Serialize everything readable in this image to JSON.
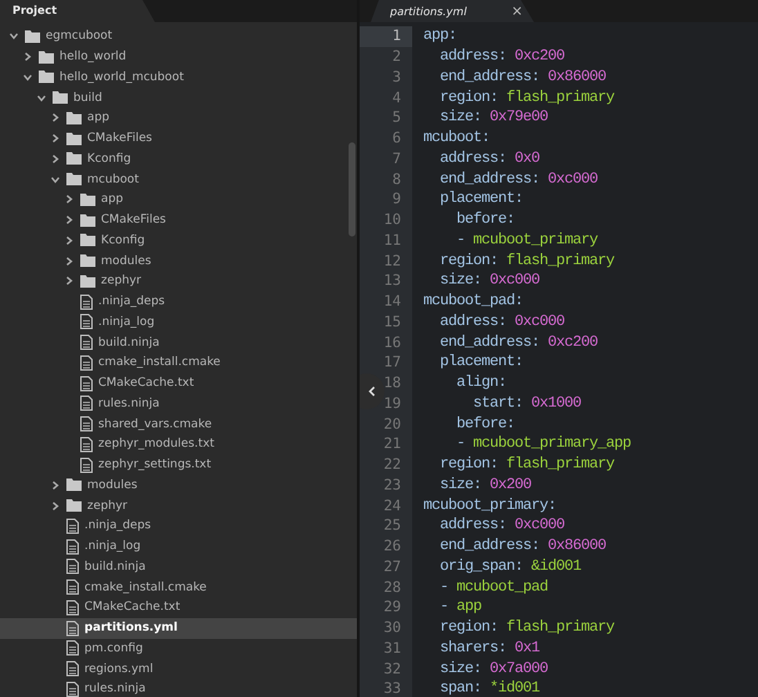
{
  "sidebar": {
    "tab": {
      "label": "Project",
      "selected": true
    },
    "tree": [
      {
        "kind": "folder",
        "name": "egmcuboot",
        "expanded": true,
        "selected": false,
        "children": [
          {
            "kind": "folder",
            "name": "hello_world",
            "expanded": false,
            "selected": false
          },
          {
            "kind": "folder",
            "name": "hello_world_mcuboot",
            "expanded": true,
            "selected": false,
            "children": [
              {
                "kind": "folder",
                "name": "build",
                "expanded": true,
                "selected": false,
                "children": [
                  {
                    "kind": "folder",
                    "name": "app",
                    "expanded": false,
                    "selected": false
                  },
                  {
                    "kind": "folder",
                    "name": "CMakeFiles",
                    "expanded": false,
                    "selected": false
                  },
                  {
                    "kind": "folder",
                    "name": "Kconfig",
                    "expanded": false,
                    "selected": false
                  },
                  {
                    "kind": "folder",
                    "name": "mcuboot",
                    "expanded": true,
                    "selected": false,
                    "children": [
                      {
                        "kind": "folder",
                        "name": "app",
                        "expanded": false,
                        "selected": false
                      },
                      {
                        "kind": "folder",
                        "name": "CMakeFiles",
                        "expanded": false,
                        "selected": false
                      },
                      {
                        "kind": "folder",
                        "name": "Kconfig",
                        "expanded": false,
                        "selected": false
                      },
                      {
                        "kind": "folder",
                        "name": "modules",
                        "expanded": false,
                        "selected": false
                      },
                      {
                        "kind": "folder",
                        "name": "zephyr",
                        "expanded": false,
                        "selected": false
                      },
                      {
                        "kind": "file",
                        "name": ".ninja_deps",
                        "selected": false
                      },
                      {
                        "kind": "file",
                        "name": ".ninja_log",
                        "selected": false
                      },
                      {
                        "kind": "file",
                        "name": "build.ninja",
                        "selected": false
                      },
                      {
                        "kind": "file",
                        "name": "cmake_install.cmake",
                        "selected": false
                      },
                      {
                        "kind": "file",
                        "name": "CMakeCache.txt",
                        "selected": false
                      },
                      {
                        "kind": "file",
                        "name": "rules.ninja",
                        "selected": false
                      },
                      {
                        "kind": "file",
                        "name": "shared_vars.cmake",
                        "selected": false
                      },
                      {
                        "kind": "file",
                        "name": "zephyr_modules.txt",
                        "selected": false
                      },
                      {
                        "kind": "file",
                        "name": "zephyr_settings.txt",
                        "selected": false
                      }
                    ]
                  },
                  {
                    "kind": "folder",
                    "name": "modules",
                    "expanded": false,
                    "selected": false
                  },
                  {
                    "kind": "folder",
                    "name": "zephyr",
                    "expanded": false,
                    "selected": false
                  },
                  {
                    "kind": "file",
                    "name": ".ninja_deps",
                    "selected": false
                  },
                  {
                    "kind": "file",
                    "name": ".ninja_log",
                    "selected": false
                  },
                  {
                    "kind": "file",
                    "name": "build.ninja",
                    "selected": false
                  },
                  {
                    "kind": "file",
                    "name": "cmake_install.cmake",
                    "selected": false
                  },
                  {
                    "kind": "file",
                    "name": "CMakeCache.txt",
                    "selected": false
                  },
                  {
                    "kind": "file",
                    "name": "partitions.yml",
                    "selected": true
                  },
                  {
                    "kind": "file",
                    "name": "pm.config",
                    "selected": false
                  },
                  {
                    "kind": "file",
                    "name": "regions.yml",
                    "selected": false
                  },
                  {
                    "kind": "file",
                    "name": "rules.ninja",
                    "selected": false
                  }
                ]
              }
            ]
          }
        ]
      }
    ]
  },
  "editor": {
    "tabs": [
      {
        "label": "partitions.yml",
        "selected": true,
        "close": "×"
      }
    ],
    "lines": [
      {
        "number": "1",
        "current": true,
        "tokens": [
          {
            "kind": "key",
            "text": "app:"
          }
        ]
      },
      {
        "number": "2",
        "current": false,
        "tokens": [
          {
            "kind": "key",
            "text": "  address:"
          },
          {
            "kind": "number",
            "text": " 0xc200"
          }
        ]
      },
      {
        "number": "3",
        "current": false,
        "tokens": [
          {
            "kind": "key",
            "text": "  end_address:"
          },
          {
            "kind": "number",
            "text": " 0x86000"
          }
        ]
      },
      {
        "number": "4",
        "current": false,
        "tokens": [
          {
            "kind": "key",
            "text": "  region:"
          },
          {
            "kind": "string",
            "text": " flash_primary"
          }
        ]
      },
      {
        "number": "5",
        "current": false,
        "tokens": [
          {
            "kind": "key",
            "text": "  size:"
          },
          {
            "kind": "number",
            "text": " 0x79e00"
          }
        ]
      },
      {
        "number": "6",
        "current": false,
        "tokens": [
          {
            "kind": "key",
            "text": "mcuboot:"
          }
        ]
      },
      {
        "number": "7",
        "current": false,
        "tokens": [
          {
            "kind": "key",
            "text": "  address:"
          },
          {
            "kind": "number",
            "text": " 0x0"
          }
        ]
      },
      {
        "number": "8",
        "current": false,
        "tokens": [
          {
            "kind": "key",
            "text": "  end_address:"
          },
          {
            "kind": "number",
            "text": " 0xc000"
          }
        ]
      },
      {
        "number": "9",
        "current": false,
        "tokens": [
          {
            "kind": "key",
            "text": "  placement:"
          }
        ]
      },
      {
        "number": "10",
        "current": false,
        "tokens": [
          {
            "kind": "key",
            "text": "    before:"
          }
        ]
      },
      {
        "number": "11",
        "current": false,
        "tokens": [
          {
            "kind": "key",
            "text": "    -"
          },
          {
            "kind": "string",
            "text": " mcuboot_primary"
          }
        ]
      },
      {
        "number": "12",
        "current": false,
        "tokens": [
          {
            "kind": "key",
            "text": "  region:"
          },
          {
            "kind": "string",
            "text": " flash_primary"
          }
        ]
      },
      {
        "number": "13",
        "current": false,
        "tokens": [
          {
            "kind": "key",
            "text": "  size:"
          },
          {
            "kind": "number",
            "text": " 0xc000"
          }
        ]
      },
      {
        "number": "14",
        "current": false,
        "tokens": [
          {
            "kind": "key",
            "text": "mcuboot_pad:"
          }
        ]
      },
      {
        "number": "15",
        "current": false,
        "tokens": [
          {
            "kind": "key",
            "text": "  address:"
          },
          {
            "kind": "number",
            "text": " 0xc000"
          }
        ]
      },
      {
        "number": "16",
        "current": false,
        "tokens": [
          {
            "kind": "key",
            "text": "  end_address:"
          },
          {
            "kind": "number",
            "text": " 0xc200"
          }
        ]
      },
      {
        "number": "17",
        "current": false,
        "tokens": [
          {
            "kind": "key",
            "text": "  placement:"
          }
        ]
      },
      {
        "number": "18",
        "current": false,
        "tokens": [
          {
            "kind": "key",
            "text": "    align:"
          }
        ]
      },
      {
        "number": "19",
        "current": false,
        "tokens": [
          {
            "kind": "key",
            "text": "      start:"
          },
          {
            "kind": "number",
            "text": " 0x1000"
          }
        ]
      },
      {
        "number": "20",
        "current": false,
        "tokens": [
          {
            "kind": "key",
            "text": "    before:"
          }
        ]
      },
      {
        "number": "21",
        "current": false,
        "tokens": [
          {
            "kind": "key",
            "text": "    -"
          },
          {
            "kind": "string",
            "text": " mcuboot_primary_app"
          }
        ]
      },
      {
        "number": "22",
        "current": false,
        "tokens": [
          {
            "kind": "key",
            "text": "  region:"
          },
          {
            "kind": "string",
            "text": " flash_primary"
          }
        ]
      },
      {
        "number": "23",
        "current": false,
        "tokens": [
          {
            "kind": "key",
            "text": "  size:"
          },
          {
            "kind": "number",
            "text": " 0x200"
          }
        ]
      },
      {
        "number": "24",
        "current": false,
        "tokens": [
          {
            "kind": "key",
            "text": "mcuboot_primary:"
          }
        ]
      },
      {
        "number": "25",
        "current": false,
        "tokens": [
          {
            "kind": "key",
            "text": "  address:"
          },
          {
            "kind": "number",
            "text": " 0xc000"
          }
        ]
      },
      {
        "number": "26",
        "current": false,
        "tokens": [
          {
            "kind": "key",
            "text": "  end_address:"
          },
          {
            "kind": "number",
            "text": " 0x86000"
          }
        ]
      },
      {
        "number": "27",
        "current": false,
        "tokens": [
          {
            "kind": "key",
            "text": "  orig_span:"
          },
          {
            "kind": "string",
            "text": " &id001"
          }
        ]
      },
      {
        "number": "28",
        "current": false,
        "tokens": [
          {
            "kind": "key",
            "text": "  -"
          },
          {
            "kind": "string",
            "text": " mcuboot_pad"
          }
        ]
      },
      {
        "number": "29",
        "current": false,
        "tokens": [
          {
            "kind": "key",
            "text": "  -"
          },
          {
            "kind": "string",
            "text": " app"
          }
        ]
      },
      {
        "number": "30",
        "current": false,
        "tokens": [
          {
            "kind": "key",
            "text": "  region:"
          },
          {
            "kind": "string",
            "text": " flash_primary"
          }
        ]
      },
      {
        "number": "31",
        "current": false,
        "tokens": [
          {
            "kind": "key",
            "text": "  sharers:"
          },
          {
            "kind": "number",
            "text": " 0x1"
          }
        ]
      },
      {
        "number": "32",
        "current": false,
        "tokens": [
          {
            "kind": "key",
            "text": "  size:"
          },
          {
            "kind": "number",
            "text": " 0x7a000"
          }
        ]
      },
      {
        "number": "33",
        "current": false,
        "tokens": [
          {
            "kind": "key",
            "text": "  span:"
          },
          {
            "kind": "string",
            "text": " *id001"
          }
        ]
      }
    ]
  }
}
